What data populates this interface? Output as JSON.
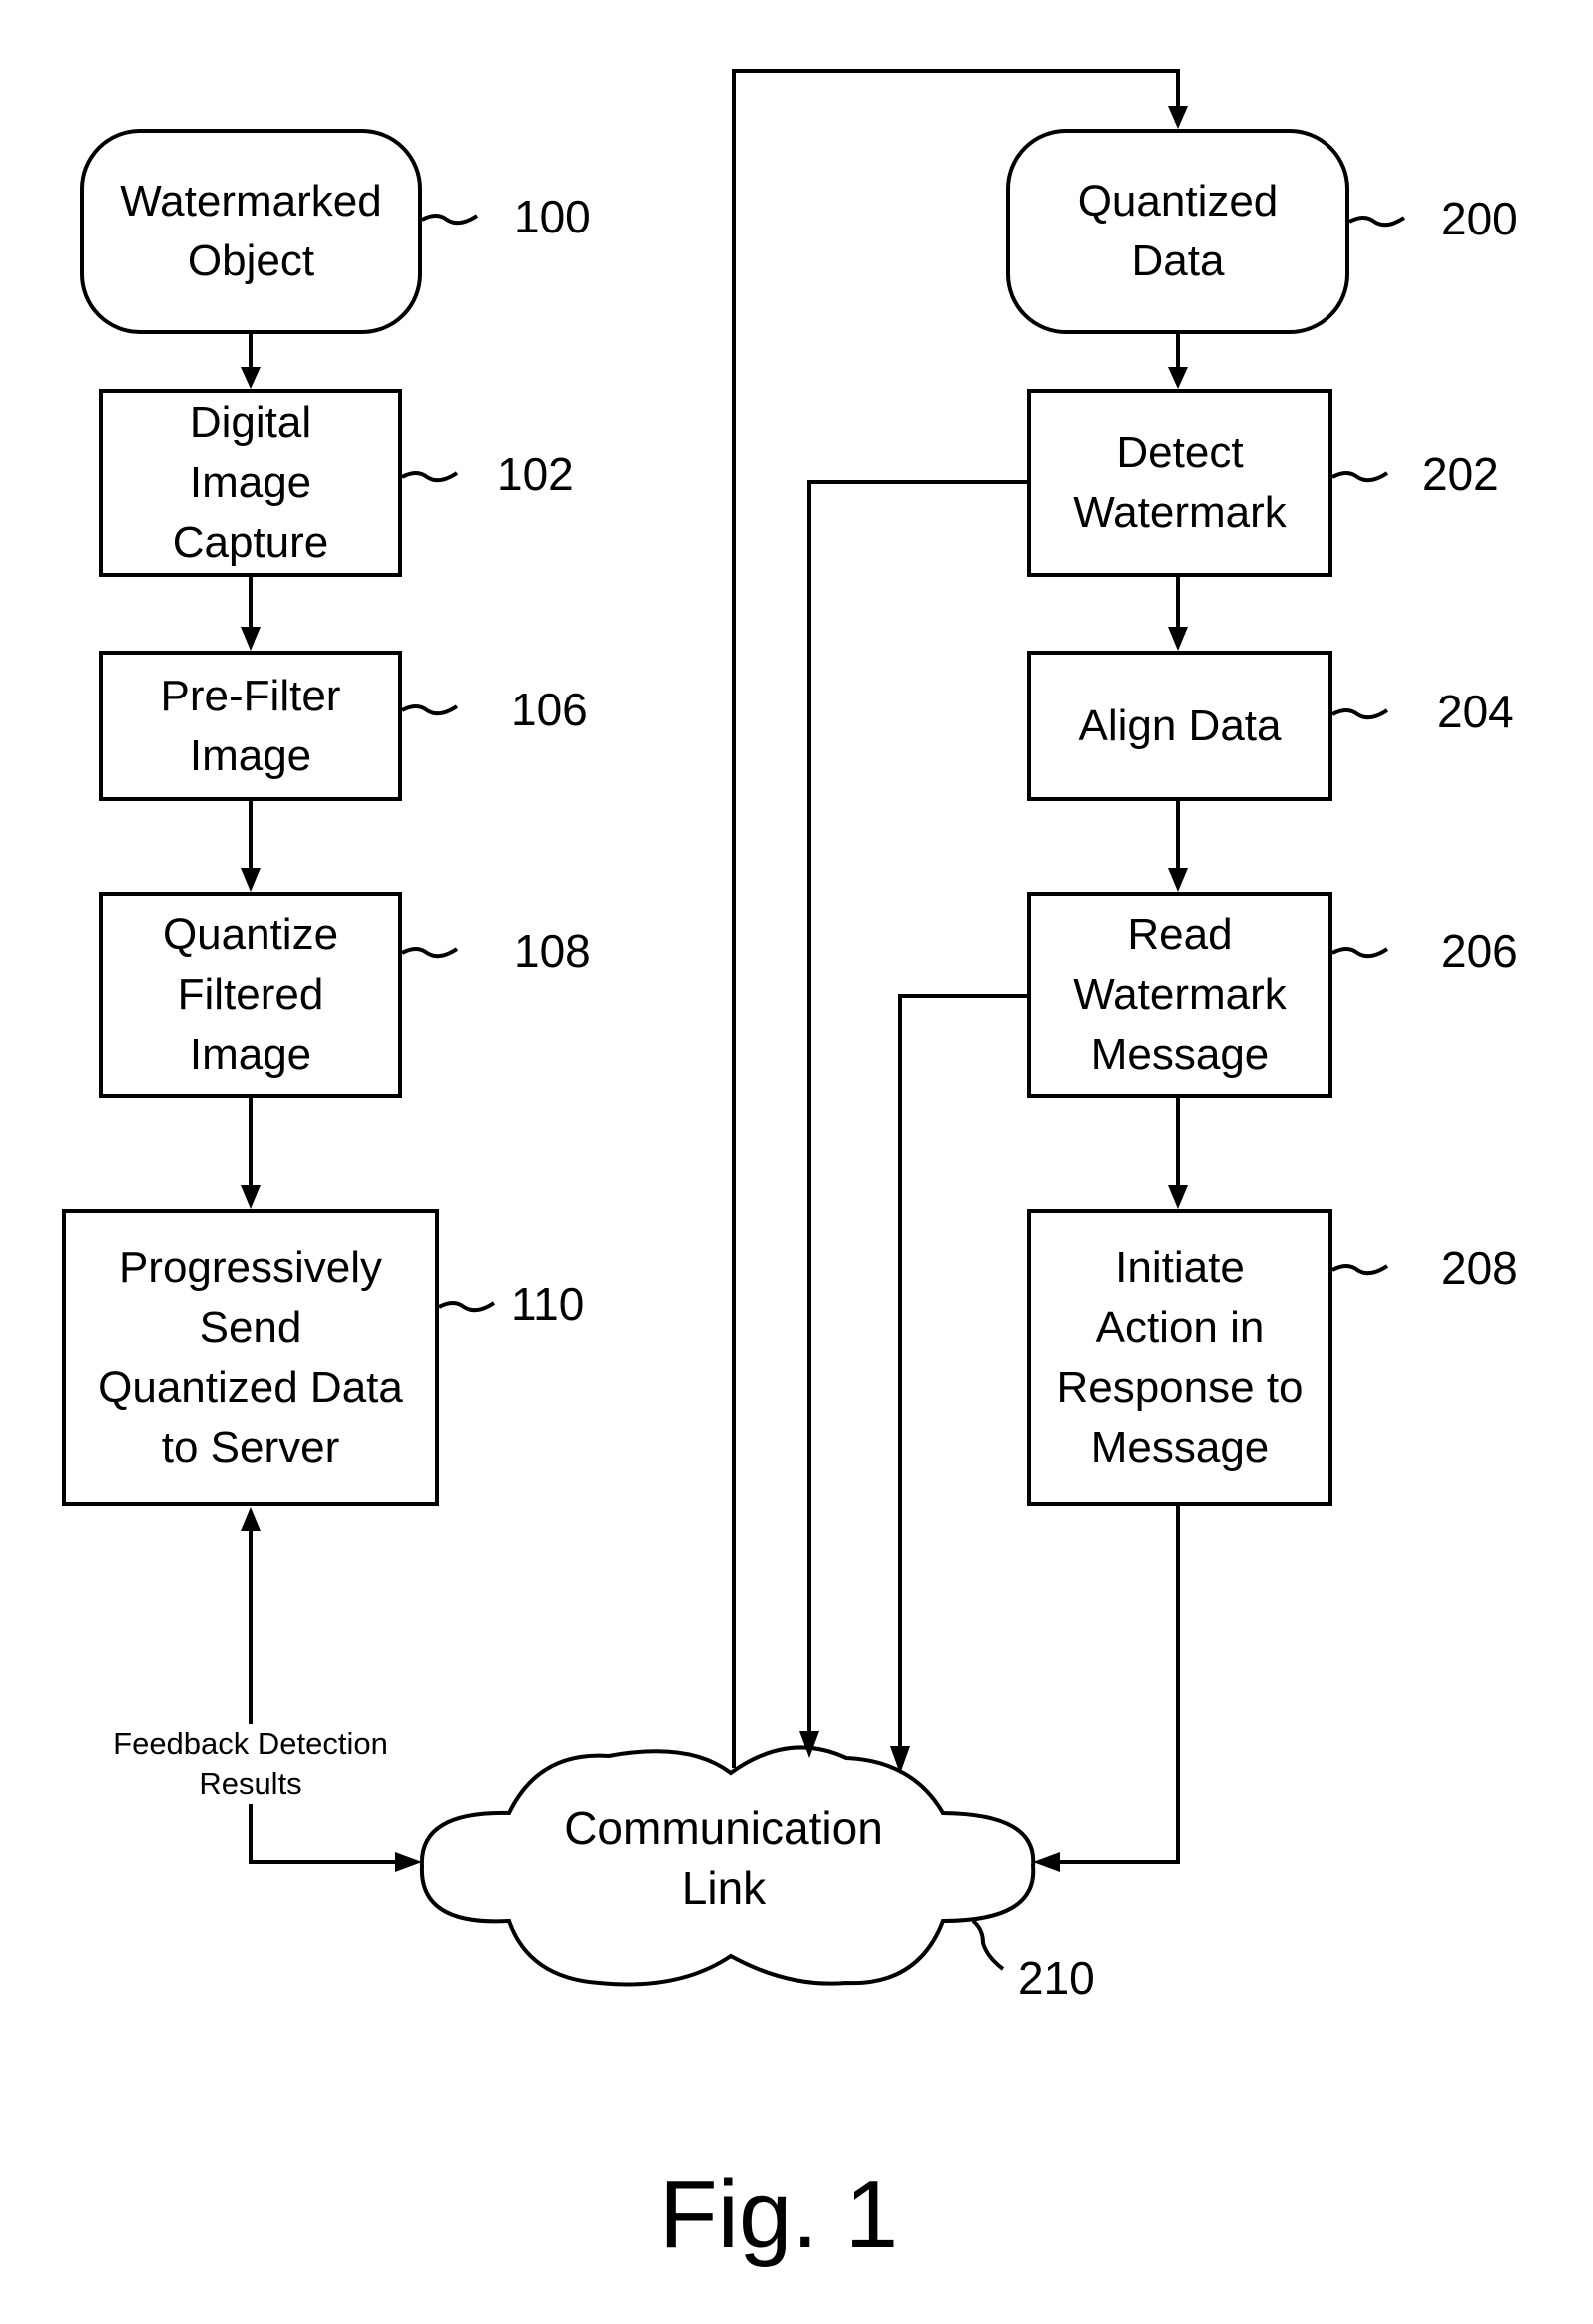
{
  "figure_label": "Fig. 1",
  "left_column": [
    {
      "id": "100",
      "label": "Watermarked\nObject",
      "ref": "100",
      "shape": "rounded"
    },
    {
      "id": "102",
      "label": "Digital\nImage\nCapture",
      "ref": "102",
      "shape": "rect"
    },
    {
      "id": "106",
      "label": "Pre-Filter\nImage",
      "ref": "106",
      "shape": "rect"
    },
    {
      "id": "108",
      "label": "Quantize\nFiltered\nImage",
      "ref": "108",
      "shape": "rect"
    },
    {
      "id": "110",
      "label": "Progressively\nSend\nQuantized Data\nto Server",
      "ref": "110",
      "shape": "rect"
    }
  ],
  "right_column": [
    {
      "id": "200",
      "label": "Quantized\nData",
      "ref": "200",
      "shape": "rounded"
    },
    {
      "id": "202",
      "label": "Detect\nWatermark",
      "ref": "202",
      "shape": "rect"
    },
    {
      "id": "204",
      "label": "Align Data",
      "ref": "204",
      "shape": "rect"
    },
    {
      "id": "206",
      "label": "Read\nWatermark\nMessage",
      "ref": "206",
      "shape": "rect"
    },
    {
      "id": "208",
      "label": "Initiate\nAction in\nResponse to\nMessage",
      "ref": "208",
      "shape": "rect"
    }
  ],
  "cloud": {
    "label": "Communication\nLink",
    "ref": "210"
  },
  "feedback_label": "Feedback Detection\nResults"
}
